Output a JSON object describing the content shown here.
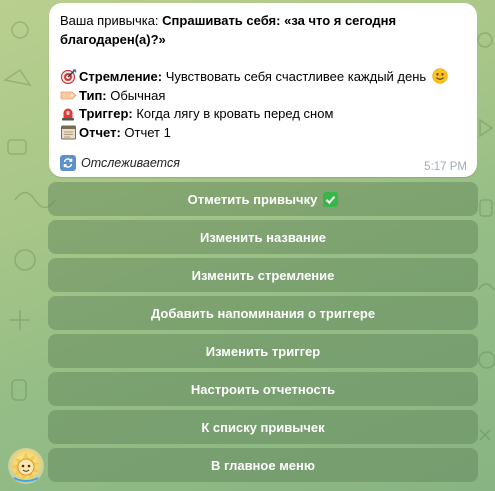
{
  "message": {
    "habit_prefix": "Ваша привычка: ",
    "habit_name_line1": "Спрашивать себя: «за что я сегодня",
    "habit_name_line2": "благодарен(а)?»",
    "aspiration_label": "Стремление:",
    "aspiration_value": " Чувствовать себя счастливее каждый день",
    "type_label": "Тип:",
    "type_value": " Обычная",
    "trigger_label": "Триггер:",
    "trigger_value": " Когда лягу в кровать перед сном",
    "report_label": "Отчет:",
    "report_value": " Отчет 1",
    "status_text": "Отслеживается",
    "time": "5:17 PM",
    "icons": [
      "target-icon",
      "label-tag-icon",
      "siren-icon",
      "report-card-icon",
      "smile-emoji-icon",
      "sync-icon"
    ]
  },
  "keyboard": {
    "buttons": [
      {
        "label": "Отметить привычку"
      },
      {
        "label": "Изменить название"
      },
      {
        "label": "Изменить стремление"
      },
      {
        "label": "Добавить напоминания о триггере"
      },
      {
        "label": "Изменить триггер"
      },
      {
        "label": "Настроить отчетность"
      },
      {
        "label": "К списку привычек"
      },
      {
        "label": "В главное меню"
      }
    ]
  },
  "colors": {
    "button_bg": "#5e8056",
    "time": "#a0acb6",
    "check": "#3bb54a"
  }
}
